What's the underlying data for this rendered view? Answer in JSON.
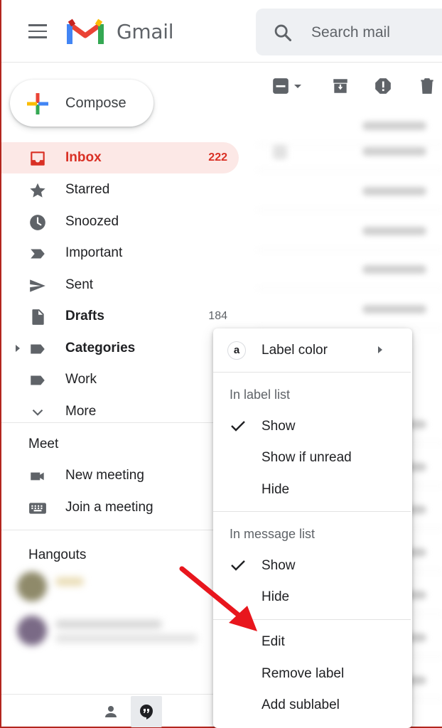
{
  "header": {
    "app_name": "Gmail",
    "search_placeholder": "Search mail"
  },
  "compose": {
    "label": "Compose"
  },
  "nav": {
    "items": [
      {
        "label": "Inbox",
        "count": "222",
        "icon": "inbox-icon"
      },
      {
        "label": "Starred",
        "count": "",
        "icon": "star-icon"
      },
      {
        "label": "Snoozed",
        "count": "",
        "icon": "clock-icon"
      },
      {
        "label": "Important",
        "count": "",
        "icon": "important-icon"
      },
      {
        "label": "Sent",
        "count": "",
        "icon": "send-icon"
      },
      {
        "label": "Drafts",
        "count": "184",
        "icon": "draft-icon"
      },
      {
        "label": "Categories",
        "count": "",
        "icon": "label-icon"
      },
      {
        "label": "Work",
        "count": "",
        "icon": "label-icon"
      },
      {
        "label": "More",
        "count": "",
        "icon": "chevron-down-icon"
      }
    ]
  },
  "meet": {
    "title": "Meet",
    "new_meeting": "New meeting",
    "join_meeting": "Join a meeting"
  },
  "hangouts": {
    "title": "Hangouts"
  },
  "context_menu": {
    "label_color": "Label color",
    "label_color_letter": "a",
    "in_label_list": "In label list",
    "label_list_options": [
      "Show",
      "Show if unread",
      "Hide"
    ],
    "in_message_list": "In message list",
    "message_list_options": [
      "Show",
      "Hide"
    ],
    "actions": [
      "Edit",
      "Remove label",
      "Add sublabel"
    ]
  },
  "colors": {
    "accent": "#d93025",
    "active_bg": "#fce8e6",
    "arrow": "#e8161d"
  }
}
